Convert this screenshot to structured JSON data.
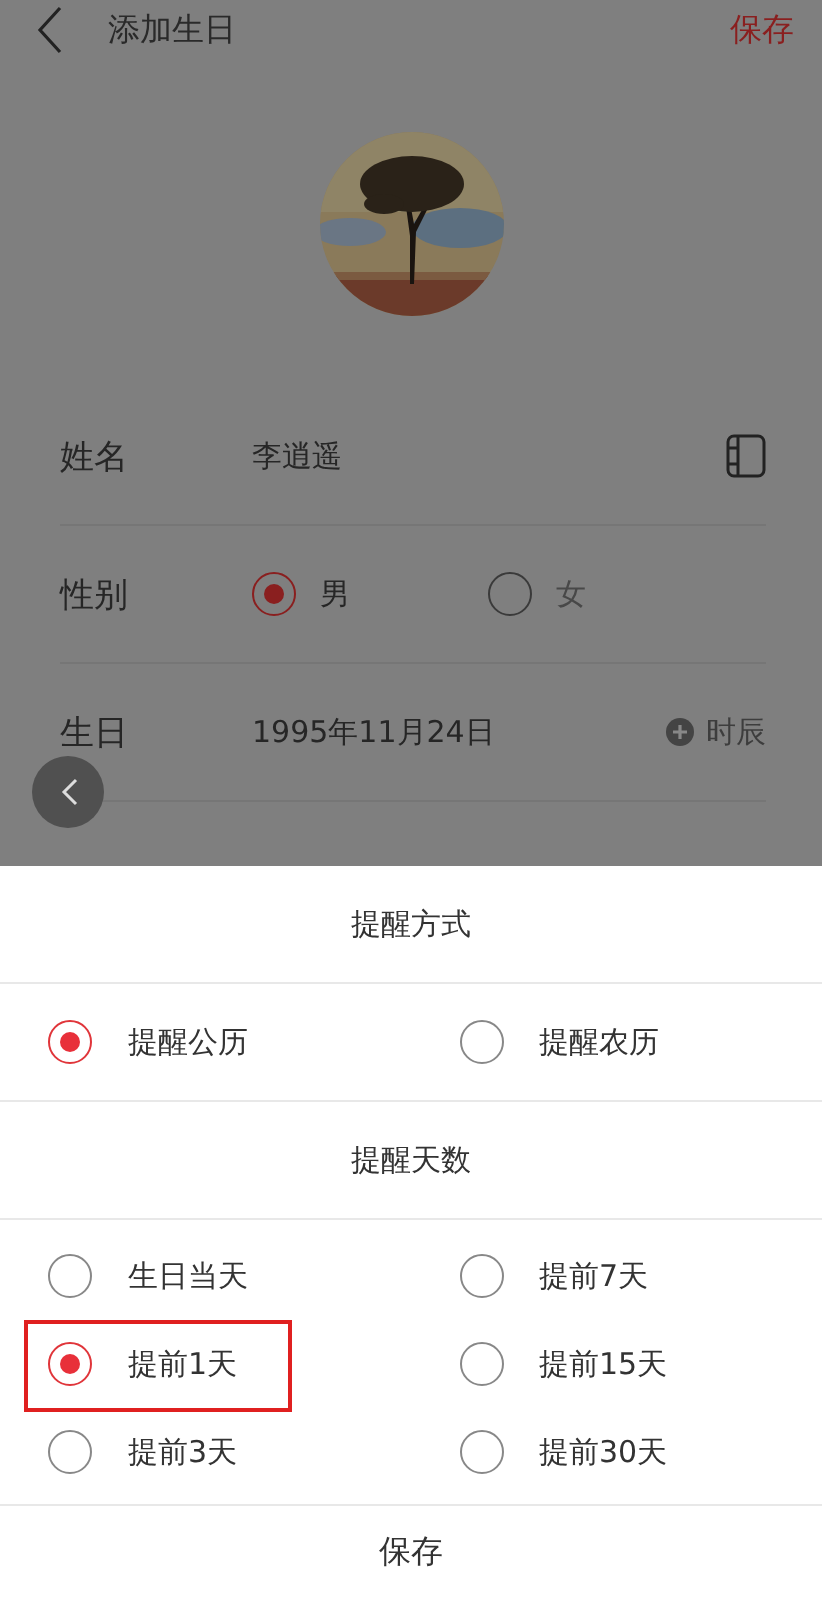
{
  "header": {
    "title": "添加生日",
    "save": "保存"
  },
  "form": {
    "name": {
      "label": "姓名",
      "value": "李逍遥"
    },
    "gender": {
      "label": "性别",
      "options": [
        {
          "label": "男",
          "selected": true
        },
        {
          "label": "女",
          "selected": false
        }
      ]
    },
    "birthday": {
      "label": "生日",
      "value": "1995年11月24日",
      "time_button": "时辰"
    }
  },
  "sheet": {
    "mode_title": "提醒方式",
    "modes": [
      {
        "label": "提醒公历",
        "selected": true
      },
      {
        "label": "提醒农历",
        "selected": false
      }
    ],
    "days_title": "提醒天数",
    "days": [
      {
        "label": "生日当天",
        "selected": false,
        "highlighted": false
      },
      {
        "label": "提前7天",
        "selected": false,
        "highlighted": false
      },
      {
        "label": "提前1天",
        "selected": true,
        "highlighted": true
      },
      {
        "label": "提前15天",
        "selected": false,
        "highlighted": false
      },
      {
        "label": "提前3天",
        "selected": false,
        "highlighted": false
      },
      {
        "label": "提前30天",
        "selected": false,
        "highlighted": false
      }
    ],
    "save": "保存"
  }
}
